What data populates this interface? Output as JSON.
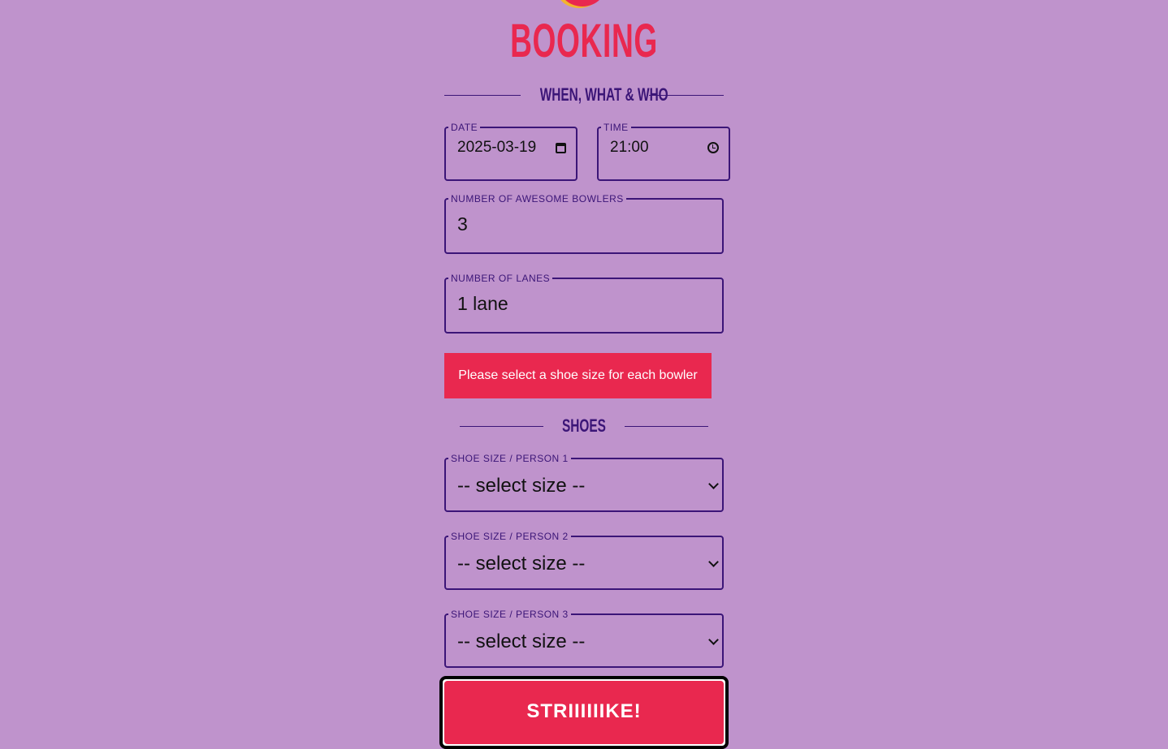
{
  "header": {
    "title": "BOOKING"
  },
  "section_when": {
    "title": "WHEN, WHAT & WHO"
  },
  "fields": {
    "date": {
      "label": "DATE",
      "value": "2025-03-19",
      "icon": "calendar-icon"
    },
    "time": {
      "label": "TIME",
      "value": "21:00",
      "icon": "clock-icon"
    },
    "bowlers": {
      "label": "NUMBER OF AWESOME BOWLERS",
      "value": "3"
    },
    "lanes": {
      "label": "NUMBER OF LANES",
      "value": "1 lane"
    }
  },
  "error": {
    "message": "Please select a shoe size for each bowler"
  },
  "section_shoes": {
    "title": "SHOES"
  },
  "shoes": [
    {
      "label": "SHOE SIZE / PERSON 1",
      "value": "-- select size --"
    },
    {
      "label": "SHOE SIZE / PERSON 2",
      "value": "-- select size --"
    },
    {
      "label": "SHOE SIZE / PERSON 3",
      "value": "-- select size --"
    }
  ],
  "submit": {
    "label": "STRIIIIIIKE!"
  },
  "colors": {
    "background": "#bf93cc",
    "accent": "#e9284f",
    "text_dark": "#3b1577"
  }
}
